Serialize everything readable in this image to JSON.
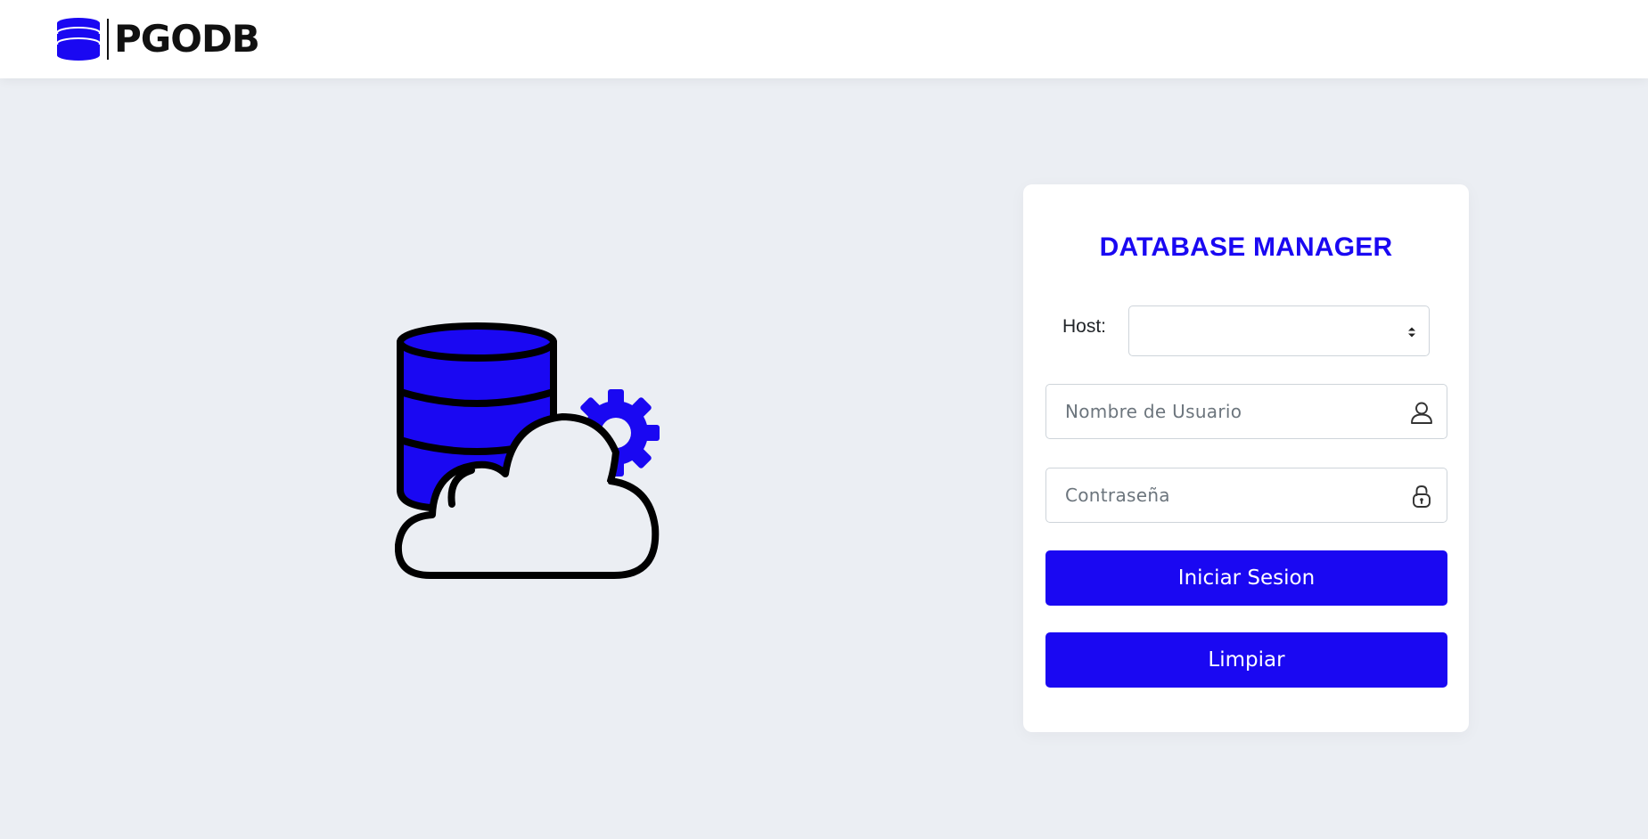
{
  "brand": {
    "name": "PGODB",
    "icon": "database-icon",
    "color": "#1a08f2"
  },
  "hero": {
    "icon": "database-cloud-gear-illustration"
  },
  "login": {
    "title": "DATABASE MANAGER",
    "host_label": "Host:",
    "host_value": "",
    "username_placeholder": "Nombre de Usuario",
    "username_icon": "user-icon",
    "password_placeholder": "Contraseña",
    "password_icon": "lock-icon",
    "login_button": "Iniciar Sesion",
    "clear_button": "Limpiar"
  },
  "colors": {
    "accent": "#1a08f2",
    "background": "#ebeef3",
    "card": "#ffffff"
  }
}
